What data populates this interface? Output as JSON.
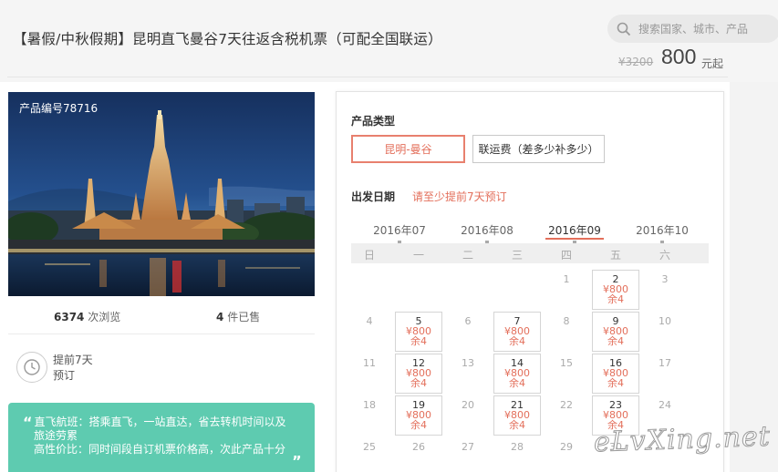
{
  "header": {
    "title": "【暑假/中秋假期】昆明直飞曼谷7天往返含税机票（可配全国联运）",
    "search_placeholder": "搜索国家、城市、产品",
    "price_old": "¥3200",
    "price_now": "800",
    "price_unit": "元起"
  },
  "product": {
    "code_label": "产品编号78716",
    "views_count": "6374",
    "views_label": "次浏览",
    "sold_count": "4",
    "sold_label": "件已售",
    "advance_line1": "提前7天",
    "advance_line2": "预订"
  },
  "features": {
    "line1": "直飞航班：搭乘直飞，一站直达，省去转机时间以及",
    "line2": "旅途劳累",
    "line3": "高性价比：同时间段自订机票价格高，次此产品十分",
    "line4": "..."
  },
  "booking": {
    "type_label": "产品类型",
    "types": [
      {
        "label": "昆明-曼谷",
        "selected": true
      },
      {
        "label": "联运费（差多少补多少）",
        "selected": false
      }
    ],
    "date_label": "出发日期",
    "date_hint": "请至少提前7天预订",
    "months": [
      "2016年07",
      "2016年08",
      "2016年09",
      "2016年10"
    ],
    "active_month": "2016年09",
    "weekdays": [
      "日",
      "一",
      "二",
      "三",
      "四",
      "五",
      "六"
    ],
    "weeks": [
      [
        "",
        "",
        "",
        "",
        "1",
        "2",
        "3"
      ],
      [
        "4",
        "5",
        "6",
        "7",
        "8",
        "9",
        "10"
      ],
      [
        "11",
        "12",
        "13",
        "14",
        "15",
        "16",
        "17"
      ],
      [
        "18",
        "19",
        "20",
        "21",
        "22",
        "23",
        "24"
      ],
      [
        "25",
        "26",
        "27",
        "28",
        "29",
        "30",
        ""
      ]
    ],
    "available": {
      "2": {
        "price": "¥800",
        "stock": "余4"
      },
      "5": {
        "price": "¥800",
        "stock": "余4"
      },
      "7": {
        "price": "¥800",
        "stock": "余4"
      },
      "9": {
        "price": "¥800",
        "stock": "余4"
      },
      "12": {
        "price": "¥800",
        "stock": "余4"
      },
      "14": {
        "price": "¥800",
        "stock": "余4"
      },
      "16": {
        "price": "¥800",
        "stock": "余4"
      },
      "19": {
        "price": "¥800",
        "stock": "余4"
      },
      "21": {
        "price": "¥800",
        "stock": "余4"
      },
      "23": {
        "price": "¥800",
        "stock": "余4"
      }
    }
  },
  "watermark": "eLvXing.net",
  "colors": {
    "accent": "#e36f5b",
    "green": "#5ecbb0"
  }
}
